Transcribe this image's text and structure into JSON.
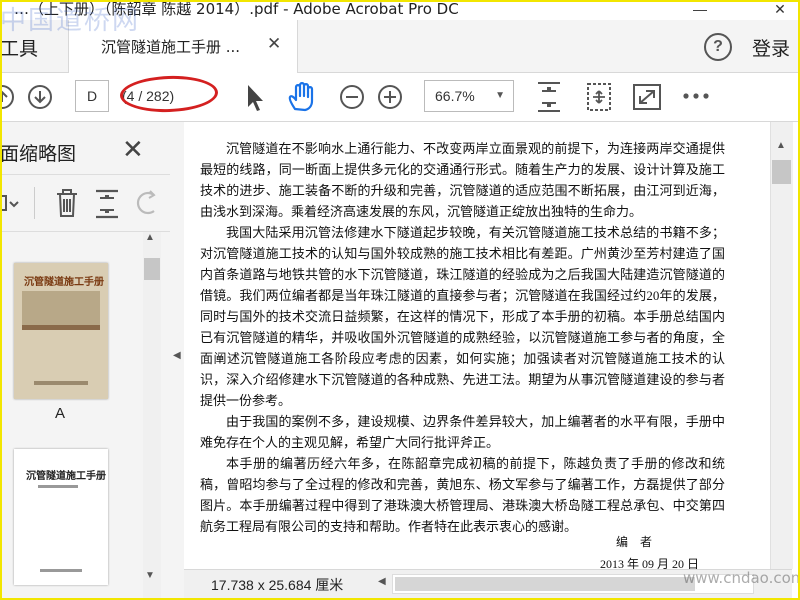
{
  "window": {
    "title": "…（上下册）（陈韶章 陈越 2014）.pdf - Adobe Acrobat Pro DC"
  },
  "tabs": {
    "tools_label": "工具",
    "doc_tab_label": "沉管隧道施工手册 ...",
    "login_label": "登录"
  },
  "toolbar": {
    "page_input_value": "D",
    "page_count": "(4 / 282)",
    "zoom_value": "66.7%"
  },
  "sidepanel": {
    "title": "页面缩略图",
    "thumb1_label": "A",
    "thumb1_book_title": "沉管隧道施工手册",
    "thumb2_book_title": "沉管隧道施工手册"
  },
  "document": {
    "paragraphs": [
      "沉管隧道在不影响水上通行能力、不改变两岸立面景观的前提下，为连接两岸交通提供最短的线路，同一断面上提供多元化的交通通行形式。随着生产力的发展、设计计算及施工技术的进步、施工装备不断的升级和完善，沉管隧道的适应范围不断拓展，由江河到近海，由浅水到深海。乘着经济高速发展的东风，沉管隧道正绽放出独特的生命力。",
      "我国大陆采用沉管法修建水下隧道起步较晚，有关沉管隧道施工技术总结的书籍不多；对沉管隧道施工技术的认知与国外较成熟的施工技术相比有差距。广州黄沙至芳村建造了国内首条道路与地铁共管的水下沉管隧道，珠江隧道的经验成为之后我国大陆建造沉管隧道的借镜。我们两位编者都是当年珠江隧道的直接参与者；沉管隧道在我国经过约20年的发展，同时与国外的技术交流日益频繁，在这样的情况下，形成了本手册的初稿。本手册总结国内已有沉管隧道的精华，并吸收国外沉管隧道的成熟经验，以沉管隧道施工参与者的角度，全面阐述沉管隧道施工各阶段应考虑的因素，如何实施；加强读者对沉管隧道施工技术的认识，深入介绍修建水下沉管隧道的各种成熟、先进工法。期望为从事沉管隧道建设的参与者提供一份参考。",
      "由于我国的案例不多，建设规模、边界条件差异较大，加上编著者的水平有限，手册中难免存在个人的主观见解，希望广大同行批评斧正。",
      "本手册的编著历经六年多，在陈韶章完成初稿的前提下，陈越负责了手册的修改和统稿，曾昭均参与了全过程的修改和完善，黄旭东、杨文军参与了编著工作，方磊提供了部分图片。本手册编著过程中得到了港珠澳大桥管理局、港珠澳大桥岛隧工程总承包、中交第四航务工程局有限公司的支持和帮助。作者特在此表示衷心的感谢。"
    ],
    "signature": "编　者",
    "date": "2013 年 09 月 20 日"
  },
  "status": {
    "page_size": "17.738 x 25.684 厘米"
  },
  "watermark": {
    "top_left": "中国道桥网",
    "bottom_right": "www.cndao.com"
  },
  "colors": {
    "annotation_oval": "#d42020",
    "frame": "#f2e600",
    "hand_tool": "#1a73e8"
  }
}
